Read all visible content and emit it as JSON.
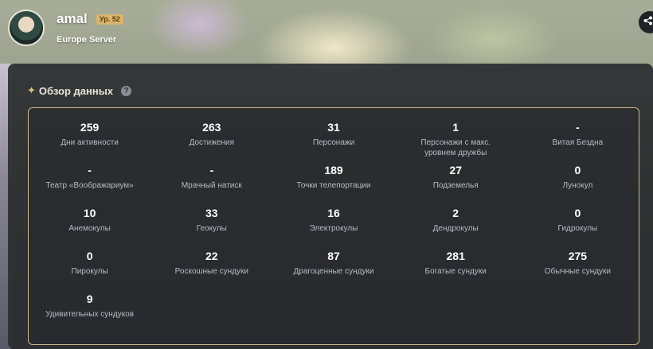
{
  "profile": {
    "username": "amal",
    "level": "Ур. 52",
    "server": "Europe Server"
  },
  "overview": {
    "title": "Обзор данных",
    "help_icon": "?"
  },
  "stats": [
    {
      "value": "259",
      "label": "Дни активности"
    },
    {
      "value": "263",
      "label": "Достижения"
    },
    {
      "value": "31",
      "label": "Персонажи"
    },
    {
      "value": "1",
      "label": "Персонажи с макс. уровнем дружбы"
    },
    {
      "value": "-",
      "label": "Витая Бездна"
    },
    {
      "value": "-",
      "label": "Театр «Воображариум»"
    },
    {
      "value": "-",
      "label": "Мрачный натиск"
    },
    {
      "value": "189",
      "label": "Точки телепортации"
    },
    {
      "value": "27",
      "label": "Подземелья"
    },
    {
      "value": "0",
      "label": "Лунокул"
    },
    {
      "value": "10",
      "label": "Анемокулы"
    },
    {
      "value": "33",
      "label": "Геокулы"
    },
    {
      "value": "16",
      "label": "Электрокулы"
    },
    {
      "value": "2",
      "label": "Дендрокулы"
    },
    {
      "value": "0",
      "label": "Гидрокулы"
    },
    {
      "value": "0",
      "label": "Пирокулы"
    },
    {
      "value": "22",
      "label": "Роскошные сундуки"
    },
    {
      "value": "87",
      "label": "Драгоценные сундуки"
    },
    {
      "value": "281",
      "label": "Богатые сундуки"
    },
    {
      "value": "275",
      "label": "Обычные сундуки"
    },
    {
      "value": "9",
      "label": "Удивительных сундуков"
    }
  ],
  "icons": {
    "share": "share-icon",
    "sparkle": "sparkle-icon",
    "help": "help-icon"
  },
  "colors": {
    "accent_gold": "#c9b68a",
    "level_badge": "#d9b46a",
    "panel_bg": "#2c2e32"
  }
}
